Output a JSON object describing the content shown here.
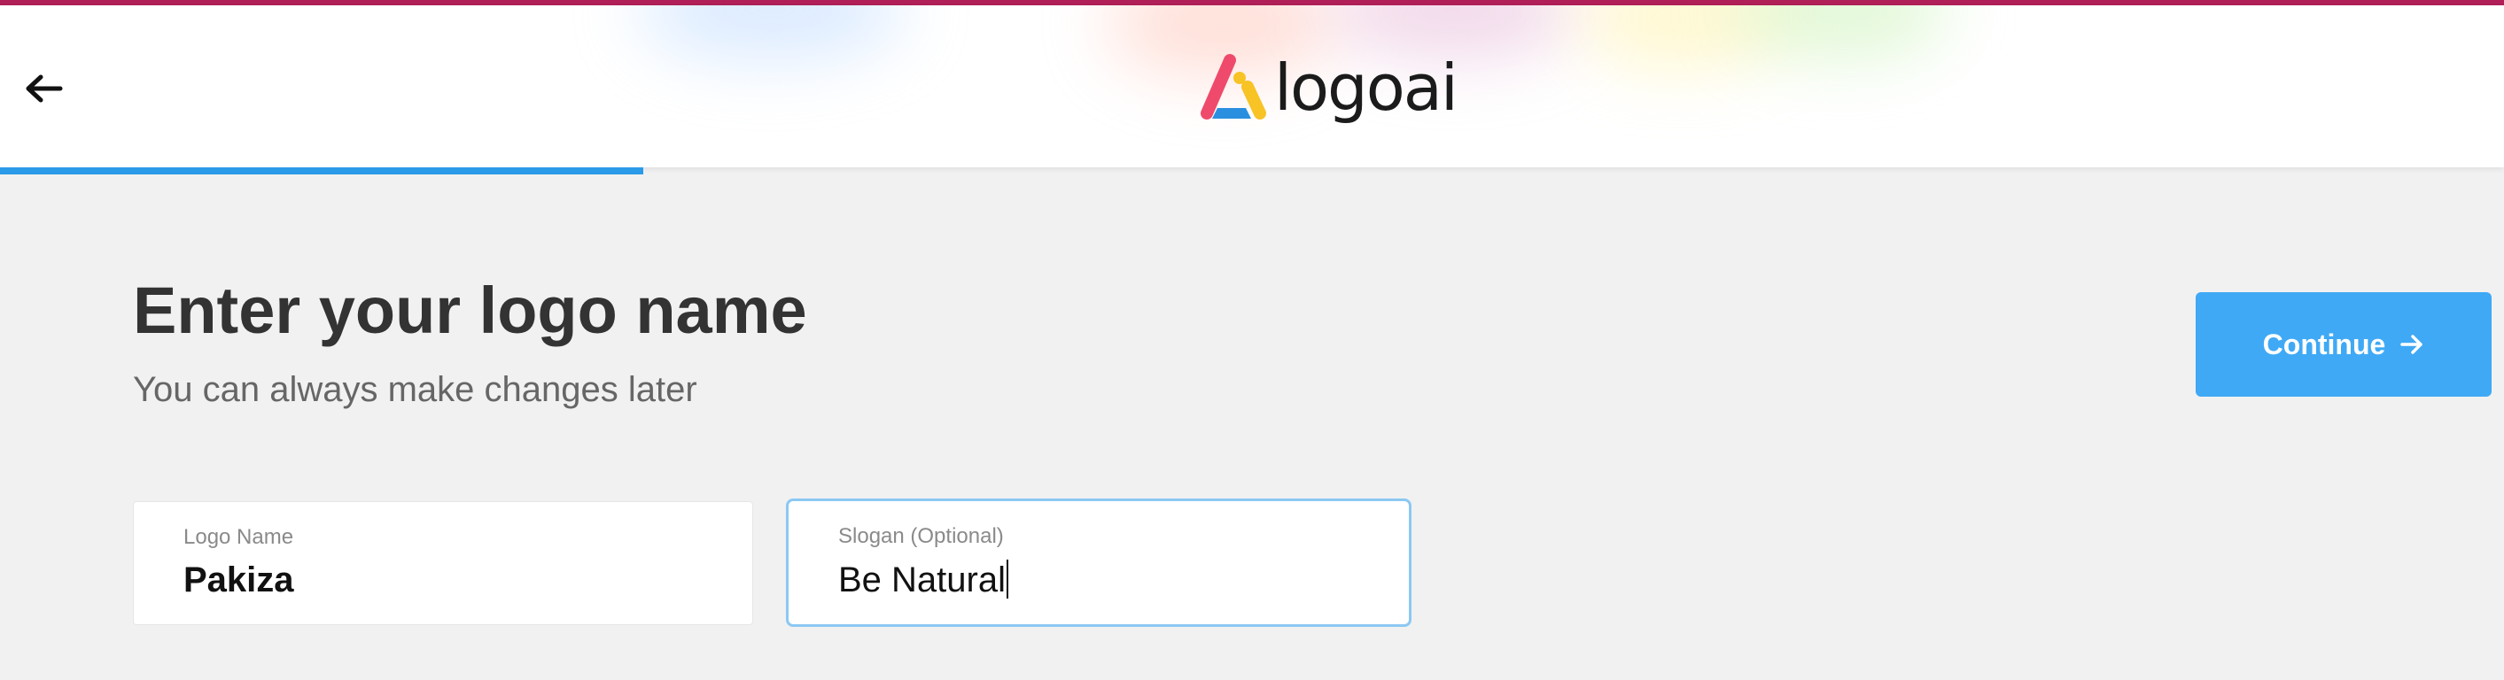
{
  "header": {
    "brand_name": "logoai",
    "accent_top_strip_color": "#b01f57",
    "back_icon": "arrow-left-icon"
  },
  "progress": {
    "fraction": 0.257,
    "color": "#2b9ae8"
  },
  "main": {
    "title": "Enter your logo name",
    "subtitle": "You can always make changes later",
    "continue_label": "Continue",
    "continue_icon": "arrow-right-icon",
    "continue_color": "#3fa9f5"
  },
  "fields": {
    "logo_name": {
      "label": "Logo Name",
      "value": "Pakiza"
    },
    "slogan": {
      "label": "Slogan (Optional)",
      "value": "Be Natural"
    }
  },
  "logo_mark_colors": {
    "pink": "#ef4a6b",
    "yellow": "#f7c325",
    "blue": "#2b8fe0"
  }
}
